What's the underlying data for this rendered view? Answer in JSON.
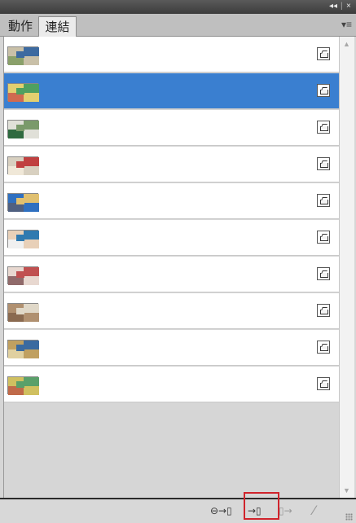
{
  "titlebar": {
    "collapse": "◂◂",
    "close": "×"
  },
  "tabs": [
    {
      "label": "動作"
    },
    {
      "label": "連結"
    }
  ],
  "panel_menu_icon": "panel-menu-icon",
  "links": [
    {
      "thumb_colors": [
        "#6a8a5a",
        "#c9c0a8",
        "#3d6aa0",
        "#8aa06a"
      ]
    },
    {
      "thumb_colors": [
        "#2f8fd0",
        "#e3d070",
        "#4fa060",
        "#d06a50"
      ],
      "selected": true
    },
    {
      "thumb_colors": [
        "#5a8a4a",
        "#e0e0d8",
        "#7a9a6a",
        "#2f6a3f"
      ]
    },
    {
      "thumb_colors": [
        "#3a6ab0",
        "#d8d0c0",
        "#c04040",
        "#f0e8d8"
      ]
    },
    {
      "thumb_colors": [
        "#3a5aa0",
        "#2f70c0",
        "#e0c070",
        "#506080"
      ]
    },
    {
      "thumb_colors": [
        "#6aa0d0",
        "#e8d0b8",
        "#2f7ab0",
        "#f0f0f0"
      ]
    },
    {
      "thumb_colors": [
        "#b03a3a",
        "#e8d8d0",
        "#c05050",
        "#906a6a"
      ]
    },
    {
      "thumb_colors": [
        "#5a7a4a",
        "#b09070",
        "#e0d8c8",
        "#8a6a50"
      ]
    },
    {
      "thumb_colors": [
        "#4a8a5a",
        "#c0a060",
        "#3a6aa0",
        "#e0d0a0"
      ]
    },
    {
      "thumb_colors": [
        "#3a8ac0",
        "#d0c060",
        "#5aa06a",
        "#c06a4a"
      ]
    }
  ],
  "bottom_buttons": [
    {
      "label": "⊖→▯",
      "name": "relink-button",
      "enabled": true
    },
    {
      "label": "→▯",
      "name": "go-to-link-button",
      "enabled": true
    },
    {
      "label": "▯→",
      "name": "update-link-button",
      "enabled": false
    },
    {
      "label": "⁄",
      "name": "edit-original-button",
      "enabled": false
    }
  ],
  "colors": {
    "selection": "#3a7fd0",
    "highlight": "#d0242c"
  }
}
